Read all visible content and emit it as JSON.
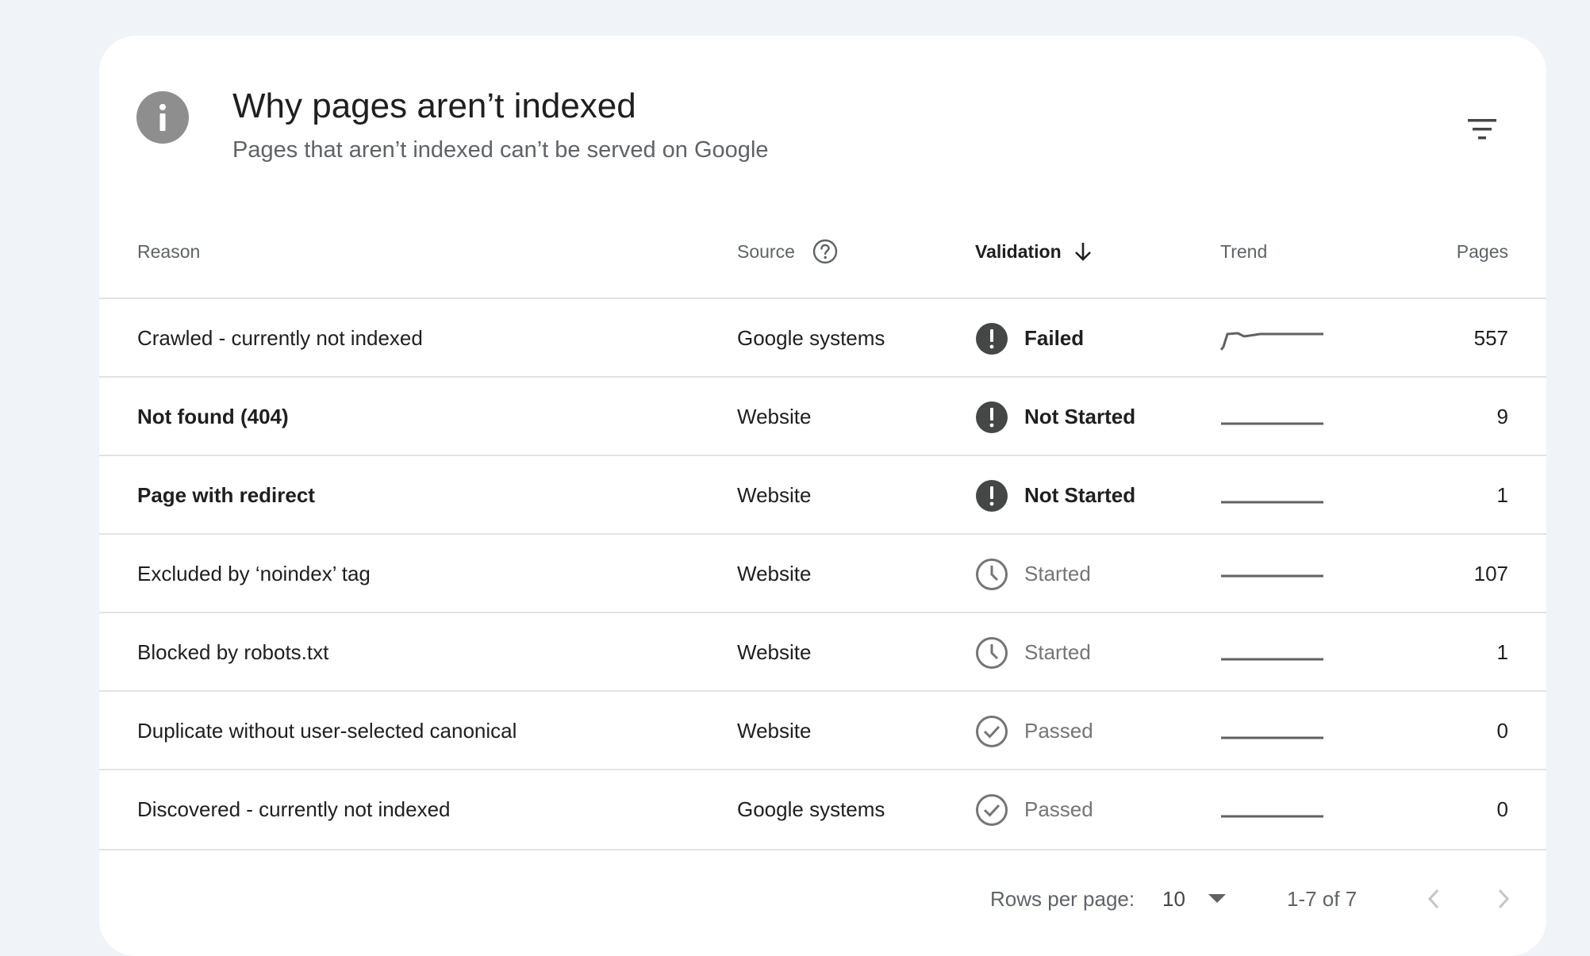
{
  "header": {
    "title": "Why pages aren’t indexed",
    "subtitle": "Pages that aren’t indexed can’t be served on Google",
    "info_icon": "info-icon",
    "filter_icon": "filter-list-icon"
  },
  "table": {
    "columns": {
      "reason": "Reason",
      "source": "Source",
      "validation": "Validation",
      "trend": "Trend",
      "pages": "Pages"
    },
    "rows": [
      {
        "reason": "Crawled - currently not indexed",
        "source": "Google systems",
        "validation": "Failed",
        "validation_icon": "alert-icon",
        "pages": "557"
      },
      {
        "reason": "Not found (404)",
        "source": "Website",
        "validation": "Not Started",
        "validation_icon": "alert-icon",
        "pages": "9"
      },
      {
        "reason": "Page with redirect",
        "source": "Website",
        "validation": "Not Started",
        "validation_icon": "alert-icon",
        "pages": "1"
      },
      {
        "reason": "Excluded by ‘noindex’ tag",
        "source": "Website",
        "validation": "Started",
        "validation_icon": "clock-icon",
        "pages": "107"
      },
      {
        "reason": "Blocked by robots.txt",
        "source": "Website",
        "validation": "Started",
        "validation_icon": "clock-icon",
        "pages": "1"
      },
      {
        "reason": "Duplicate without user-selected canonical",
        "source": "Website",
        "validation": "Passed",
        "validation_icon": "check-circle-icon",
        "pages": "0"
      },
      {
        "reason": "Discovered - currently not indexed",
        "source": "Google systems",
        "validation": "Passed",
        "validation_icon": "check-circle-icon",
        "pages": "0"
      }
    ]
  },
  "footer": {
    "rows_per_page_label": "Rows per page:",
    "rows_per_page_value": "10",
    "range": "1-7 of 7"
  },
  "colors": {
    "alert": "#444746",
    "icon_gray": "#757575",
    "trend_line": "#616161",
    "background": "#f0f4f9"
  }
}
